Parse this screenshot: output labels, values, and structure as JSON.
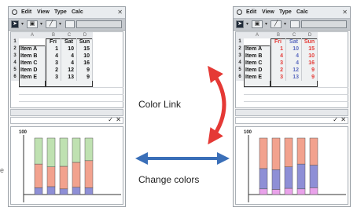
{
  "menu": {
    "items": [
      "Edit",
      "View",
      "Type",
      "Calc"
    ]
  },
  "sheet": {
    "col_letters": [
      "A",
      "B",
      "C",
      "D"
    ],
    "headers": [
      "Fri",
      "Sat",
      "Sun"
    ],
    "rows": [
      {
        "num": "1",
        "label": "",
        "values": [
          "",
          "",
          ""
        ]
      },
      {
        "num": "2",
        "label": "Item A",
        "values": [
          "1",
          "10",
          "15"
        ]
      },
      {
        "num": "3",
        "label": "Item B",
        "values": [
          "4",
          "4",
          "10"
        ]
      },
      {
        "num": "4",
        "label": "Item C",
        "values": [
          "3",
          "4",
          "16"
        ]
      },
      {
        "num": "5",
        "label": "Item D",
        "values": [
          "2",
          "12",
          "9"
        ]
      },
      {
        "num": "6",
        "label": "Item E",
        "values": [
          "3",
          "13",
          "9"
        ]
      }
    ]
  },
  "right_sheet_header_colors": [
    "#e53935",
    "#5c6bc0",
    "#e53935"
  ],
  "graph": {
    "ytick": "100"
  },
  "chart_data_left": {
    "type": "bar",
    "stacked": true,
    "segment_colors": [
      "#8e8fd6",
      "#f2a28e",
      "#bfe1b1"
    ],
    "bars": [
      [
        12,
        42,
        46
      ],
      [
        14,
        35,
        51
      ],
      [
        10,
        40,
        50
      ],
      [
        13,
        44,
        43
      ],
      [
        12,
        48,
        40
      ]
    ]
  },
  "chart_data_right": {
    "type": "bar",
    "stacked": true,
    "segment_colors": [
      "#e9a2ea",
      "#8e8fd6",
      "#f2a28e"
    ],
    "bars": [
      [
        10,
        36,
        54
      ],
      [
        9,
        35,
        56
      ],
      [
        11,
        38,
        51
      ],
      [
        10,
        44,
        46
      ],
      [
        12,
        40,
        48
      ]
    ]
  },
  "labels": {
    "color_link": "Color Link",
    "change_colors": "Change colors",
    "edge_char": "e"
  },
  "colors": {
    "red_arrow": "#e53935",
    "blue_arrow": "#3a6fb8"
  },
  "icons": [
    "menu-icon",
    "pointer-tool-icon",
    "chart-tool-icon",
    "line-tool-icon",
    "close-icon"
  ]
}
